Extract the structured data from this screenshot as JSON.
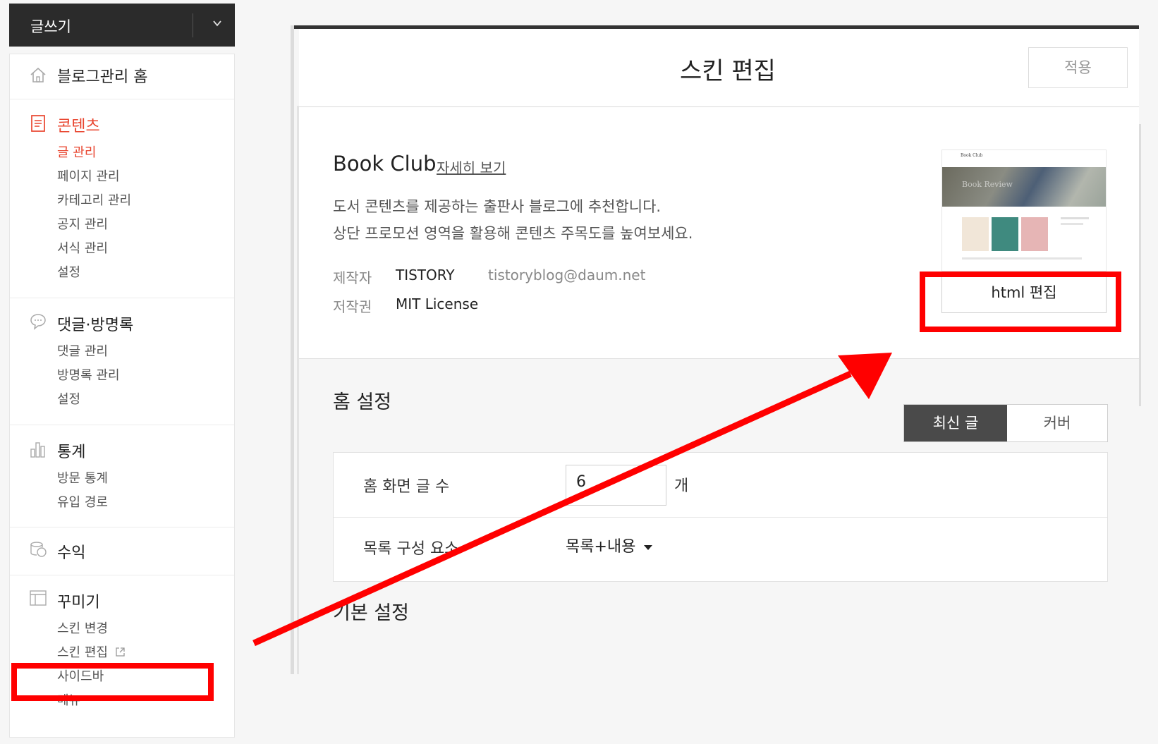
{
  "write_button": {
    "label": "글쓰기"
  },
  "sidebar": {
    "home": {
      "label": "블로그관리 홈"
    },
    "contents": {
      "label": "콘텐츠",
      "items": [
        "글 관리",
        "페이지 관리",
        "카테고리 관리",
        "공지 관리",
        "서식 관리",
        "설정"
      ]
    },
    "comments": {
      "label": "댓글·방명록",
      "items": [
        "댓글 관리",
        "방명록 관리",
        "설정"
      ]
    },
    "stats": {
      "label": "통계",
      "items": [
        "방문 통계",
        "유입 경로"
      ]
    },
    "revenue": {
      "label": "수익"
    },
    "decorate": {
      "label": "꾸미기",
      "items": [
        "스킨 변경",
        "스킨 편집",
        "사이드바",
        "메뉴"
      ]
    }
  },
  "header": {
    "title": "스킨 편집",
    "apply_label": "적용"
  },
  "skin": {
    "name": "Book Club",
    "detail_link": "자세히 보기",
    "desc1": "도서 콘텐츠를 제공하는 출판사 블로그에 추천합니다.",
    "desc2": "상단 프로모션 영역을 활용해 콘텐츠 주목도를 높여보세요.",
    "author_key": "제작자",
    "author": "TISTORY",
    "author_email": "tistoryblog@daum.net",
    "license_key": "저작권",
    "license": "MIT License",
    "html_edit_label": "html 편집",
    "thumb_title": "Book Club",
    "thumb_banner": "Book Review"
  },
  "home_settings": {
    "title": "홈 설정",
    "toggle_on": "최신 글",
    "toggle_off": "커버",
    "post_count_label": "홈 화면 글 수",
    "post_count": "6",
    "post_count_unit": "개",
    "list_label": "목록 구성 요소",
    "list_value": "목록+내용"
  },
  "basic_settings": {
    "title": "기본 설정"
  },
  "colors": {
    "accent_red": "#e8442e",
    "annotation_red": "#ff0000",
    "dark_button": "#2b2b2b",
    "toggle_active": "#4a4a4a"
  }
}
